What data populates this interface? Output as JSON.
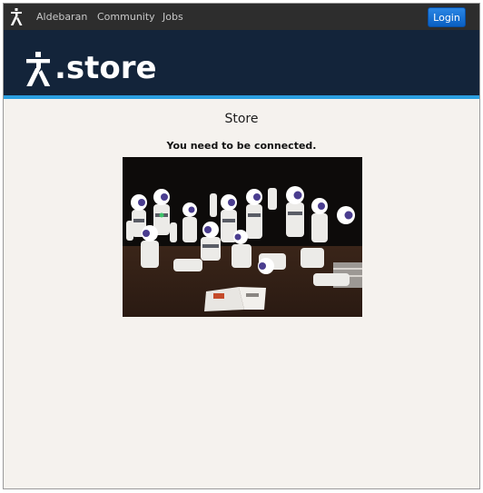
{
  "nav": {
    "items": [
      {
        "label": "Aldebaran"
      },
      {
        "label": "Community"
      },
      {
        "label": "Jobs"
      }
    ],
    "login_label": "Login"
  },
  "banner": {
    "brand_text": ".store"
  },
  "main": {
    "title": "Store",
    "notice": "You need to be connected."
  },
  "colors": {
    "topbar": "#2d2d2d",
    "banner": "#13243a",
    "accent": "#2b9fe0",
    "login_button": "#1a73d6",
    "page_background": "#f5f2ee"
  },
  "icons": {
    "nav_logo": "robot-logo-icon",
    "banner_logo": "robot-logo-icon"
  }
}
